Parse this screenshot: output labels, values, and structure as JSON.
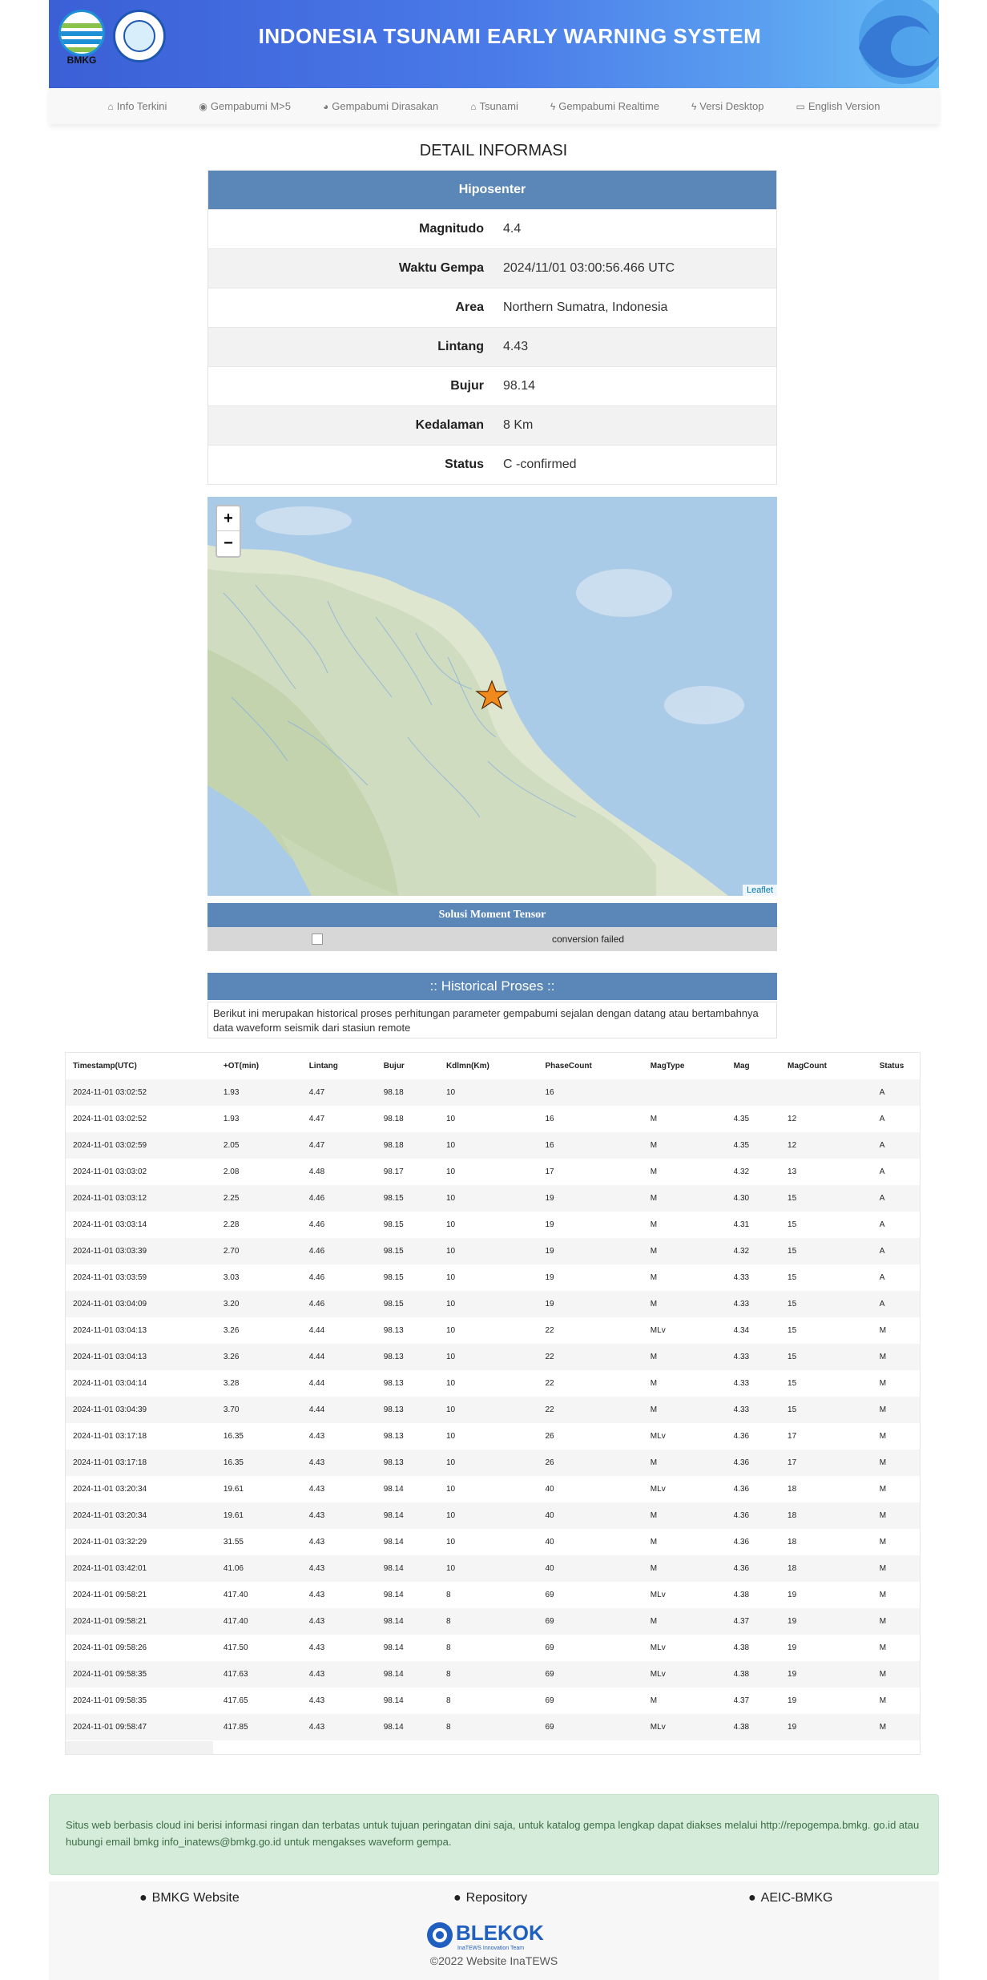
{
  "header": {
    "title": "INDONESIA TSUNAMI EARLY WARNING SYSTEM",
    "logo_text": "BMKG"
  },
  "nav": {
    "items": [
      {
        "label": "Info Terkini",
        "icon": "home-icon"
      },
      {
        "label": "Gempabumi M>5",
        "icon": "dot-circle-icon"
      },
      {
        "label": "Gempabumi Dirasakan",
        "icon": "globe-icon"
      },
      {
        "label": "Tsunami",
        "icon": "home-icon"
      },
      {
        "label": "Gempabumi Realtime",
        "icon": "bolt-icon"
      },
      {
        "label": "Versi Desktop",
        "icon": "bolt-icon"
      },
      {
        "label": "English Version",
        "icon": "language-icon"
      }
    ]
  },
  "detail": {
    "title": "DETAIL INFORMASI",
    "section": "Hiposenter",
    "rows": [
      {
        "k": "Magnitudo",
        "v": "4.4"
      },
      {
        "k": "Waktu Gempa",
        "v": "2024/11/01 03:00:56.466 UTC"
      },
      {
        "k": "Area",
        "v": "Northern Sumatra, Indonesia"
      },
      {
        "k": "Lintang",
        "v": "4.43"
      },
      {
        "k": "Bujur",
        "v": "98.14"
      },
      {
        "k": "Kedalaman",
        "v": "8 Km"
      },
      {
        "k": "Status",
        "v": "C -confirmed"
      }
    ]
  },
  "map": {
    "zoom_in": "+",
    "zoom_out": "−",
    "attribution": "Leaflet"
  },
  "moment_tensor": {
    "title": "Solusi Moment Tensor",
    "message": "conversion failed"
  },
  "historical": {
    "title": ":: Historical Proses ::",
    "description": "Berikut ini merupakan historical proses perhitungan parameter gempabumi sejalan dengan datang atau bertambahnya data waveform seismik dari stasiun remote",
    "columns": [
      "Timestamp(UTC)",
      "+OT(min)",
      "Lintang",
      "Bujur",
      "Kdlmn(Km)",
      "PhaseCount",
      "MagType",
      "Mag",
      "MagCount",
      "Status"
    ],
    "rows": [
      [
        "2024-11-01 03:02:52",
        "1.93",
        "4.47",
        "98.18",
        "10",
        "16",
        "",
        "",
        "",
        "A"
      ],
      [
        "2024-11-01 03:02:52",
        "1.93",
        "4.47",
        "98.18",
        "10",
        "16",
        "M",
        "4.35",
        "12",
        "A"
      ],
      [
        "2024-11-01 03:02:59",
        "2.05",
        "4.47",
        "98.18",
        "10",
        "16",
        "M",
        "4.35",
        "12",
        "A"
      ],
      [
        "2024-11-01 03:03:02",
        "2.08",
        "4.48",
        "98.17",
        "10",
        "17",
        "M",
        "4.32",
        "13",
        "A"
      ],
      [
        "2024-11-01 03:03:12",
        "2.25",
        "4.46",
        "98.15",
        "10",
        "19",
        "M",
        "4.30",
        "15",
        "A"
      ],
      [
        "2024-11-01 03:03:14",
        "2.28",
        "4.46",
        "98.15",
        "10",
        "19",
        "M",
        "4.31",
        "15",
        "A"
      ],
      [
        "2024-11-01 03:03:39",
        "2.70",
        "4.46",
        "98.15",
        "10",
        "19",
        "M",
        "4.32",
        "15",
        "A"
      ],
      [
        "2024-11-01 03:03:59",
        "3.03",
        "4.46",
        "98.15",
        "10",
        "19",
        "M",
        "4.33",
        "15",
        "A"
      ],
      [
        "2024-11-01 03:04:09",
        "3.20",
        "4.46",
        "98.15",
        "10",
        "19",
        "M",
        "4.33",
        "15",
        "A"
      ],
      [
        "2024-11-01 03:04:13",
        "3.26",
        "4.44",
        "98.13",
        "10",
        "22",
        "MLv",
        "4.34",
        "15",
        "M"
      ],
      [
        "2024-11-01 03:04:13",
        "3.26",
        "4.44",
        "98.13",
        "10",
        "22",
        "M",
        "4.33",
        "15",
        "M"
      ],
      [
        "2024-11-01 03:04:14",
        "3.28",
        "4.44",
        "98.13",
        "10",
        "22",
        "M",
        "4.33",
        "15",
        "M"
      ],
      [
        "2024-11-01 03:04:39",
        "3.70",
        "4.44",
        "98.13",
        "10",
        "22",
        "M",
        "4.33",
        "15",
        "M"
      ],
      [
        "2024-11-01 03:17:18",
        "16.35",
        "4.43",
        "98.13",
        "10",
        "26",
        "MLv",
        "4.36",
        "17",
        "M"
      ],
      [
        "2024-11-01 03:17:18",
        "16.35",
        "4.43",
        "98.13",
        "10",
        "26",
        "M",
        "4.36",
        "17",
        "M"
      ],
      [
        "2024-11-01 03:20:34",
        "19.61",
        "4.43",
        "98.14",
        "10",
        "40",
        "MLv",
        "4.36",
        "18",
        "M"
      ],
      [
        "2024-11-01 03:20:34",
        "19.61",
        "4.43",
        "98.14",
        "10",
        "40",
        "M",
        "4.36",
        "18",
        "M"
      ],
      [
        "2024-11-01 03:32:29",
        "31.55",
        "4.43",
        "98.14",
        "10",
        "40",
        "M",
        "4.36",
        "18",
        "M"
      ],
      [
        "2024-11-01 03:42:01",
        "41.06",
        "4.43",
        "98.14",
        "10",
        "40",
        "M",
        "4.36",
        "18",
        "M"
      ],
      [
        "2024-11-01 09:58:21",
        "417.40",
        "4.43",
        "98.14",
        "8",
        "69",
        "MLv",
        "4.38",
        "19",
        "M"
      ],
      [
        "2024-11-01 09:58:21",
        "417.40",
        "4.43",
        "98.14",
        "8",
        "69",
        "M",
        "4.37",
        "19",
        "M"
      ],
      [
        "2024-11-01 09:58:26",
        "417.50",
        "4.43",
        "98.14",
        "8",
        "69",
        "MLv",
        "4.38",
        "19",
        "M"
      ],
      [
        "2024-11-01 09:58:35",
        "417.63",
        "4.43",
        "98.14",
        "8",
        "69",
        "MLv",
        "4.38",
        "19",
        "M"
      ],
      [
        "2024-11-01 09:58:35",
        "417.65",
        "4.43",
        "98.14",
        "8",
        "69",
        "M",
        "4.37",
        "19",
        "M"
      ],
      [
        "2024-11-01 09:58:47",
        "417.85",
        "4.43",
        "98.14",
        "8",
        "69",
        "MLv",
        "4.38",
        "19",
        "M"
      ]
    ]
  },
  "alert": {
    "text": "Situs web berbasis cloud ini berisi informasi ringan dan terbatas untuk tujuan peringatan dini saja, untuk katalog gempa lengkap dapat diakses melalui http://repogempa.bmkg. go.id atau hubungi email bmkg info_inatews@bmkg.go.id untuk mengakses waveform gempa."
  },
  "footer": {
    "links": [
      "BMKG Website",
      "Repository",
      "AEIC-BMKG"
    ],
    "logo_text": "BLEKOK",
    "logo_sub": "InaTEWS Innovation Team",
    "copyright": "©2022 Website InaTEWS"
  },
  "colors": {
    "header_gradient_start": "#3b5fd6",
    "header_gradient_end": "#6cc0f6",
    "section_blue": "#5a87b8",
    "alert_green": "#d4ecd9",
    "epicenter_star": "#f08a1c"
  }
}
